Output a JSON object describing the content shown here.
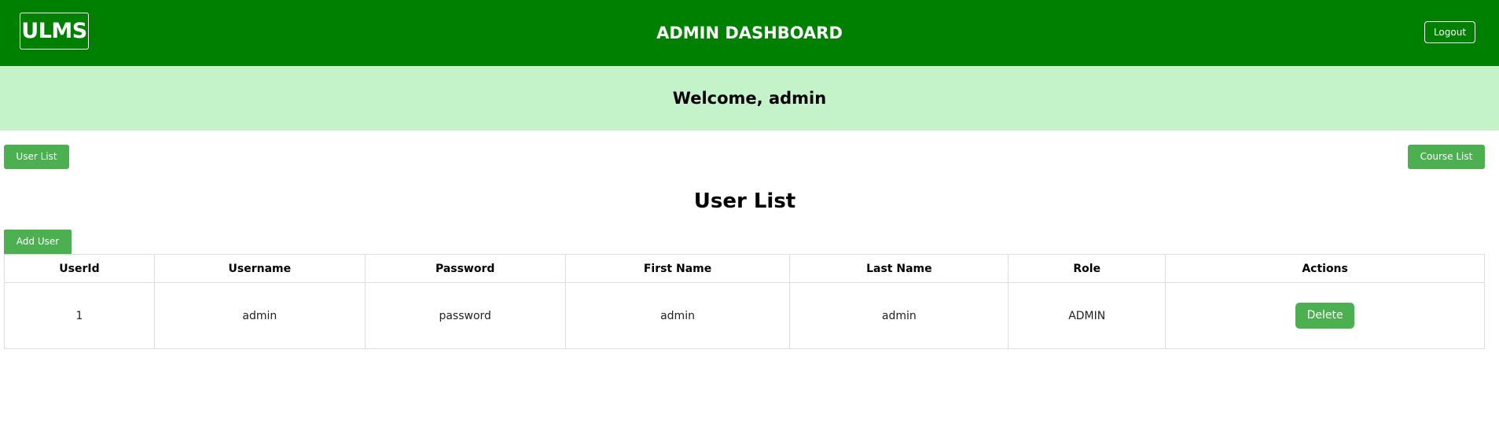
{
  "header": {
    "logo_text": "ULMS",
    "title": "ADMIN DASHBOARD",
    "logout_label": "Logout",
    "bg_color": "#008000"
  },
  "welcome": {
    "text": "Welcome, admin",
    "bg_color": "#c4f2c9"
  },
  "nav": {
    "user_list_label": "User List",
    "course_list_label": "Course List"
  },
  "main": {
    "section_title": "User List",
    "add_user_label": "Add User",
    "button_color": "#4caf50"
  },
  "table": {
    "headers": [
      "UserId",
      "Username",
      "Password",
      "First Name",
      "Last Name",
      "Role",
      "Actions"
    ],
    "rows": [
      {
        "userid": "1",
        "username": "admin",
        "password": "password",
        "first_name": "admin",
        "last_name": "admin",
        "role": "ADMIN",
        "action_label": "Delete"
      }
    ]
  }
}
